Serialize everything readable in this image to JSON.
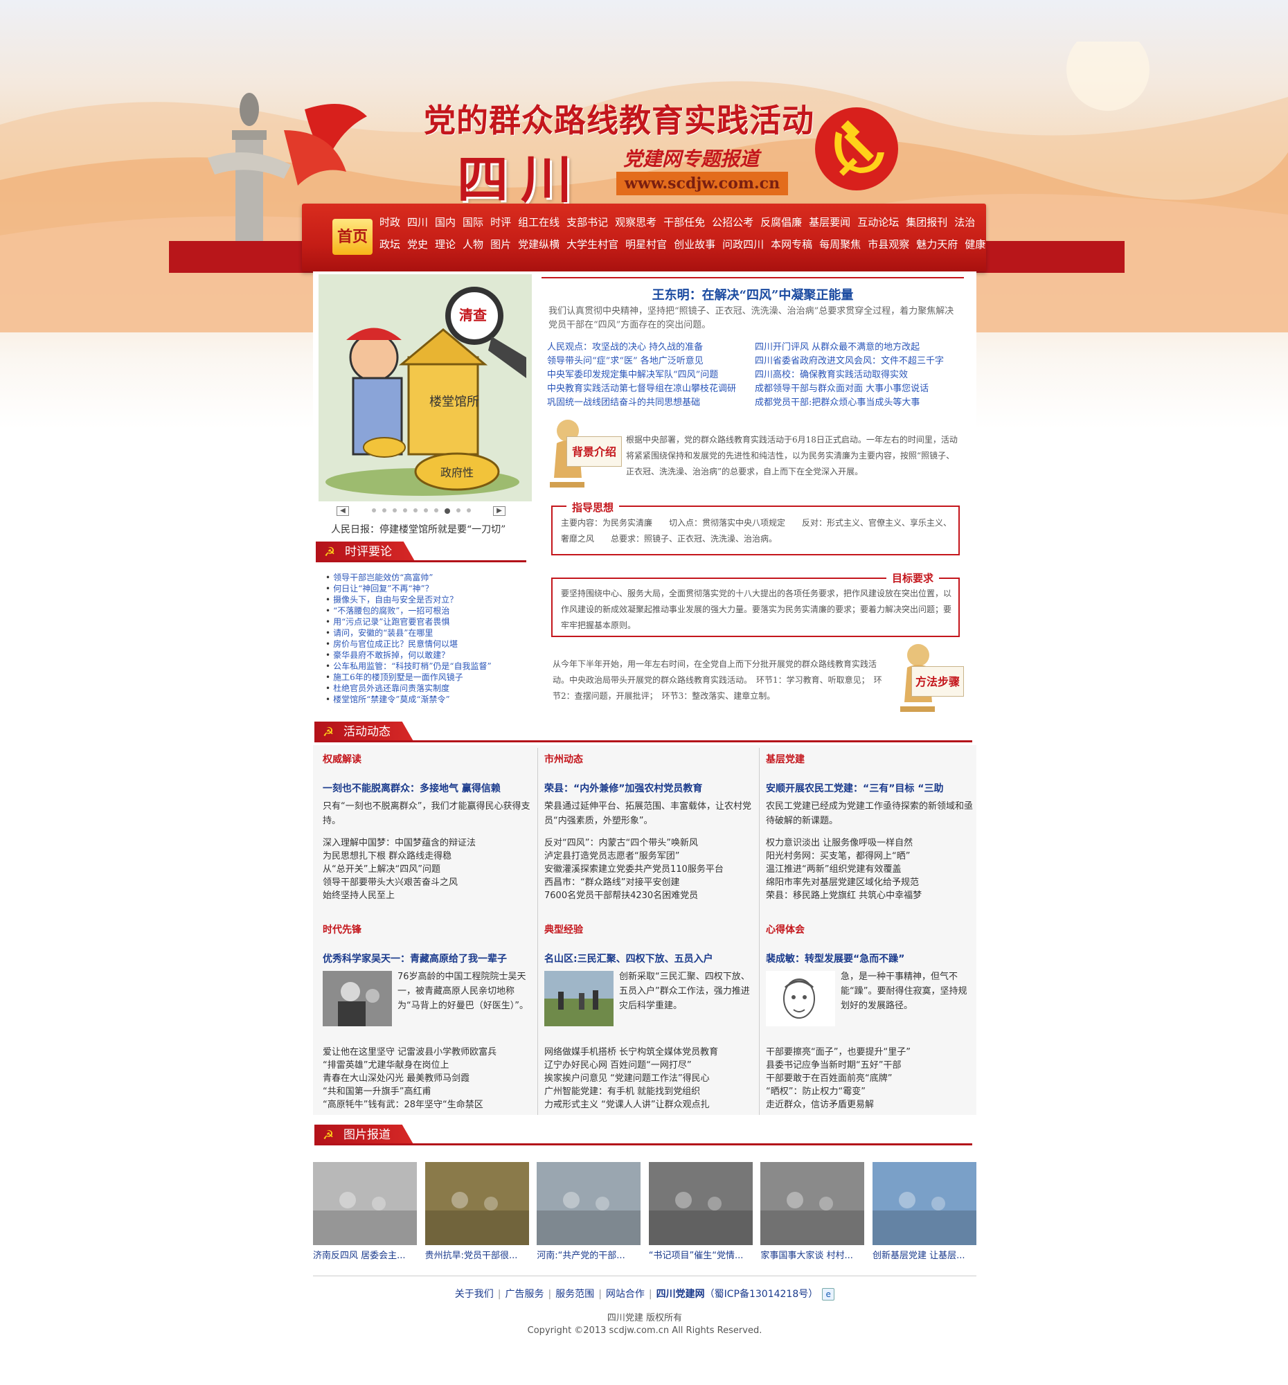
{
  "header": {
    "title": "党的群众路线教育实践活动",
    "sichuan": "四川",
    "subtitle": "党建网专题报道",
    "url": "www.scdjw.com.cn"
  },
  "nav": {
    "home": "首页",
    "row1": [
      "时政",
      "四川",
      "国内",
      "国际",
      "时评",
      "组工在线",
      "支部书记",
      "观察思考",
      "干部任免",
      "公招公考",
      "反腐倡廉",
      "基层要闻",
      "互动论坛",
      "集团报刊",
      "法治"
    ],
    "row2": [
      "政坛",
      "党史",
      "理论",
      "人物",
      "图片",
      "党建纵横",
      "大学生村官",
      "明星村官",
      "创业故事",
      "问政四川",
      "本网专稿",
      "每周聚焦",
      "市县观察",
      "魅力天府",
      "健康"
    ]
  },
  "slide": {
    "caption": "人民日报：停建楼堂馆所就是要“一刀切”",
    "labels": [
      "清查",
      "楼堂馆所",
      "政府性"
    ]
  },
  "pinglun": {
    "title": "时评要论",
    "items": [
      "领导干部岂能效仿“高富帅”",
      "何日让“神回复”不再“神”？",
      "摄像头下，自由与安全是否对立？",
      "“不落腰包的腐败”，一招可根治",
      "用“污点记录”让跑官要官者畏惧",
      "请问，安徽的“装县”在哪里",
      "房价与官位成正比？民意情何以堪",
      "豪华县府不敢拆掉，何以敢建？",
      "公车私用监管：“科技盯梢”仍是“自我监督”",
      "施工6年的楼顶别墅是一面作风镜子",
      "杜绝官员外逃还靠问责落实制度",
      "楼堂馆所“禁建令”莫成“渐禁令”"
    ]
  },
  "lead": {
    "title": "王东明：在解决“四风”中凝聚正能量",
    "summary": "我们认真贯彻中央精神，坚持把“照镜子、正衣冠、洗洗澡、治治病”总要求贯穿全过程，着力聚焦解决党员干部在“四风”方面存在的突出问题。",
    "links_left": [
      "人民观点：攻坚战的决心 持久战的准备",
      "领导带头问“症”求“医” 各地广泛听意见",
      "中央军委印发规定集中解决军队“四风”问题",
      "中央教育实践活动第七督导组在凉山攀枝花调研",
      "巩固统一战线团结奋斗的共同思想基础"
    ],
    "links_right": [
      "四川开门评风 从群众最不满意的地方改起",
      "四川省委省政府改进文风会风：文件不超三千字",
      "四川高校：确保教育实践活动取得实效",
      "成都领导干部与群众面对面 大事小事您说话",
      "成都党员干部:把群众烦心事当成头等大事"
    ]
  },
  "background": {
    "label": "背景介绍",
    "text": "根据中央部署，党的群众路线教育实践活动于6月18日正式启动。一年左右的时间里，活动将紧紧围绕保持和发展党的先进性和纯洁性，以为民务实清廉为主要内容，按照“照镜子、正衣冠、洗洗澡、治治病”的总要求，自上而下在全党深入开展。"
  },
  "guide": {
    "label": "指导思想",
    "text": "主要内容：为民务实清廉　　切入点：贯彻落实中央八项规定　　反对：形式主义、官僚主义、享乐主义、奢靡之风　　总要求：照镜子、正衣冠、洗洗澡、治治病。"
  },
  "goal": {
    "label": "目标要求",
    "text": "要坚持围绕中心、服务大局，全面贯彻落实党的十八大提出的各项任务要求，把作风建设放在突出位置，以作风建设的新成效凝聚起推动事业发展的强大力量。要落实为民务实清廉的要求；要着力解决突出问题；要牢牢把握基本原则。"
  },
  "method": {
    "label": "方法步骤",
    "text": "从今年下半年开始，用一年左右时间，在全党自上而下分批开展党的群众路线教育实践活动。中央政治局带头开展党的群众路线教育实践活动。　环节1：学习教育、听取意见；　环节2：查摆问题，开展批评；　环节3：整改落实、建章立制。"
  },
  "activity": {
    "title": "活动动态",
    "cols": [
      {
        "cat": "权威解读",
        "head": "一刻也不能脱离群众：多接地气 赢得信赖",
        "desc": "只有“一刻也不脱离群众”，我们才能赢得民心获得支持。",
        "links": [
          "深入理解中国梦：中国梦蕴含的辩证法",
          "为民思想扎下根 群众路线走得稳",
          "从“总开关”上解决“四风”问题",
          "领导干部要带头大兴艰苦奋斗之风",
          "始终坚持人民至上"
        ]
      },
      {
        "cat": "市州动态",
        "head": "荣县：“内外兼修”加强农村党员教育",
        "desc": "荣县通过延伸平台、拓展范围、丰富载体，让农村党员“内强素质，外塑形象”。",
        "links": [
          "反对“四风”：内蒙古“四个带头”唤新风",
          "泸定县打造党员志愿者“服务军团”",
          "安徽灌溪探索建立党委共产党员110服务平台",
          "西昌市：“群众路线”对接平安创建",
          "7600名党员干部帮扶4230名困难党员"
        ]
      },
      {
        "cat": "基层党建",
        "head": "安顺开展农民工党建：“三有”目标 “三助",
        "desc": "农民工党建已经成为党建工作亟待探索的新领域和亟待破解的新课题。",
        "links": [
          "权力意识淡出 让服务像呼吸一样自然",
          "阳光村务网：买支笔，都得网上“晒”",
          "温江推进“两新”组织党建有效覆盖",
          "绵阳市率先对基层党建区域化给予规范",
          "荣县：移民路上党旗红 共筑心中幸福梦"
        ]
      },
      {
        "cat": "时代先锋",
        "head": "优秀科学家吴天一：青藏高原给了我一辈子",
        "desc": "76岁高龄的中国工程院院士吴天一，被青藏高原人民亲切地称为“马背上的好曼巴（好医生）”。",
        "links": [
          "爱让他在这里坚守 记雷波县小学教师欧富兵",
          "“排雷英雄”尤建华献身在岗位上",
          "青春在大山深处闪光 最美教师马剑霞",
          "“共和国第一升旗手”高红甫",
          "“高原牦牛”钱有武：28年坚守“生命禁区"
        ]
      },
      {
        "cat": "典型经验",
        "head": "名山区:三民汇聚、四权下放、五员入户",
        "desc": "创新采取“三民汇聚、四权下放、五员入户”群众工作法，强力推进灾后科学重建。",
        "links": [
          "网络做媒手机搭桥 长宁构筑全媒体党员教育",
          "辽宁办好民心网 百姓问题“一网打尽”",
          "挨家挨户问意见 “党建问题工作法”得民心",
          "广州智能党建：有手机 就能找到党组织",
          "力戒形式主义 “党课人人讲”让群众观点扎"
        ]
      },
      {
        "cat": "心得体会",
        "head": "裴成敏：转型发展要“急而不躁”",
        "desc": "急，是一种干事精神，但气不能“躁”。要耐得住寂寞，坚持规划好的发展路径。",
        "links": [
          "干部要擦亮“面子”，也要提升“里子”",
          "县委书记应争当新时期“五好”干部",
          "干部要敢于在百姓面前亮“底牌”",
          "“晒权”：防止权力“霉变”",
          "走近群众，信访矛盾更易解"
        ]
      }
    ]
  },
  "pictures": {
    "title": "图片报道",
    "items": [
      {
        "caption": "济南反四风 居委会主...",
        "color": "#b8b8b8"
      },
      {
        "caption": "贵州抗旱:党员干部很...",
        "color": "#8a7a4a"
      },
      {
        "caption": "河南:“共产党的干部...",
        "color": "#9aa6b0"
      },
      {
        "caption": "“书记项目”催生“党情...",
        "color": "#777777"
      },
      {
        "caption": "家事国事大家谈 村村...",
        "color": "#8a8a8a"
      },
      {
        "caption": "创新基层党建 让基层...",
        "color": "#7aa0c8"
      }
    ]
  },
  "footer": {
    "links": [
      "关于我们",
      "广告服务",
      "服务范围",
      "网站合作"
    ],
    "brand": "四川党建网",
    "icp": "蜀ICP备13014218号",
    "copy1": "四川党建 版权所有",
    "copy2": "Copyright ©2013 scdjw.com.cn All Rights Reserved."
  }
}
